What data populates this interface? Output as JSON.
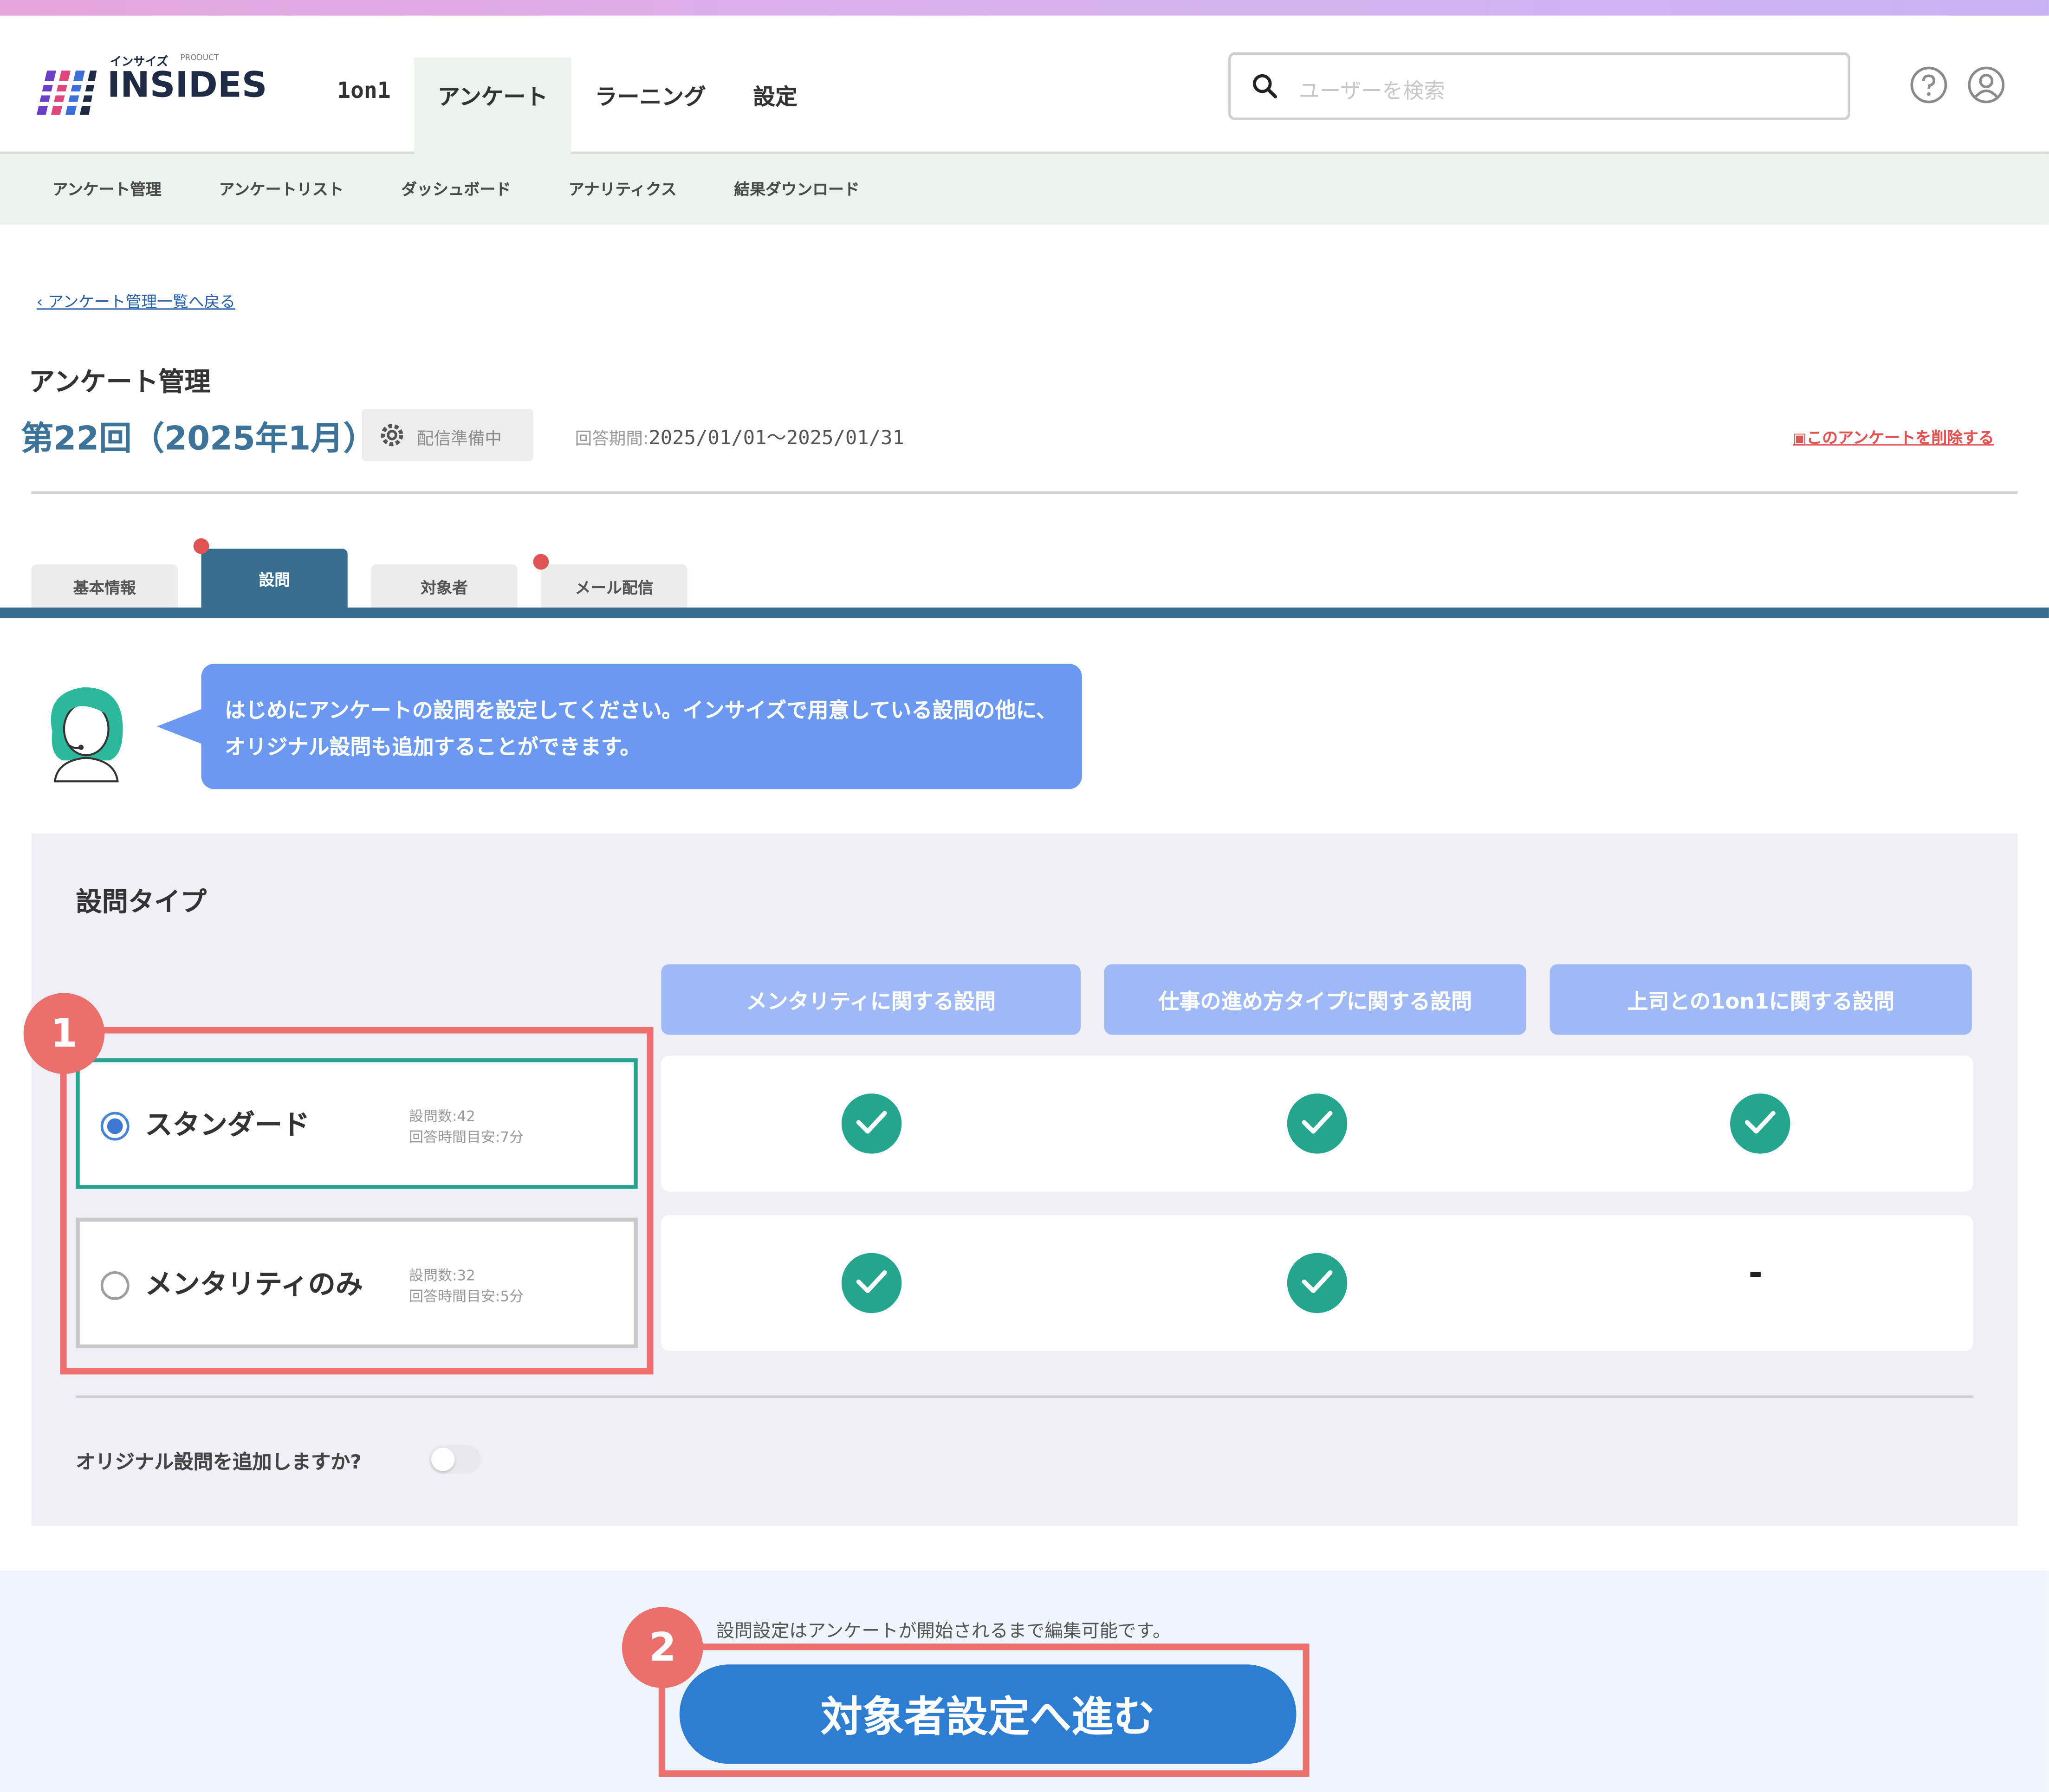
{
  "header": {
    "logo_text": "INSIDES",
    "logo_small": "インサイズ",
    "logo_small2": "PRODUCT",
    "nav": [
      "1on1",
      "アンケート",
      "ラーニング",
      "設定"
    ],
    "search_placeholder": "ユーザーを検索"
  },
  "subnav": [
    "アンケート管理",
    "アンケートリスト",
    "ダッシュボード",
    "アナリティクス",
    "結果ダウンロード"
  ],
  "back_link": "‹ アンケート管理一覧へ戻る",
  "page_heading": "アンケート管理",
  "survey": {
    "title": "第22回（2025年1月）",
    "status": "配信準備中",
    "period_label": "回答期間:",
    "period_value": "2025/01/01〜2025/01/31",
    "delete_label": "このアンケートを削除する"
  },
  "tabs": [
    "基本情報",
    "設問",
    "対象者",
    "メール配信"
  ],
  "bubble_text": "はじめにアンケートの設問を設定してください。インサイズで用意している設問の他に、オリジナル設問も追加することができます。",
  "panel": {
    "title": "設問タイプ",
    "columns": [
      "メンタリティに関する設問",
      "仕事の進め方タイプに関する設問",
      "上司との1on1に関する設問"
    ],
    "options": [
      {
        "name": "スタンダード",
        "count": "設問数:42",
        "time": "回答時間目安:7分",
        "checks": [
          true,
          true,
          true
        ]
      },
      {
        "name": "メンタリティのみ",
        "count": "設問数:32",
        "time": "回答時間目安:5分",
        "checks": [
          true,
          true,
          false
        ]
      }
    ],
    "dash": "-",
    "add_question": "オリジナル設問を追加しますか?"
  },
  "footer": {
    "note": "設問設定はアンケートが開始されるまで編集可能です。",
    "cta": "対象者設定へ進む"
  },
  "badges": [
    "1",
    "2"
  ],
  "colors": {
    "accent": "#2d7dd2",
    "teal": "#26a58e",
    "tab_active": "#376d8f",
    "highlight": "#ef6f6f"
  }
}
